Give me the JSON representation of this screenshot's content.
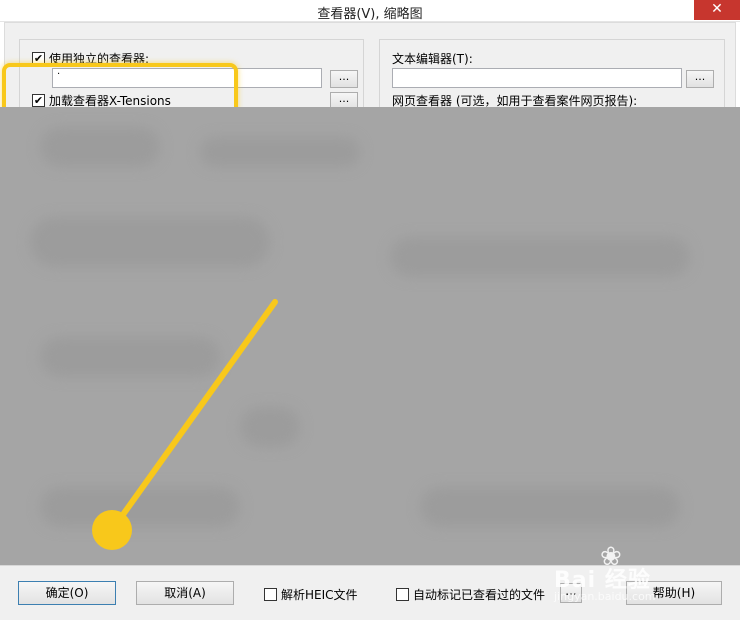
{
  "window": {
    "title": "查看器(V), 缩略图",
    "close_glyph": "✕"
  },
  "left_group": {
    "use_separate_viewer_label": "使用独立的查看器:",
    "use_separate_viewer_checked": true,
    "viewer_path_value": "·",
    "browse_label": "...",
    "load_xtensions_label": "加载查看器X-Tensions",
    "load_xtensions_checked": true
  },
  "right_group": {
    "text_editor_label": "文本编辑器(T):",
    "text_editor_value": "",
    "browse_label": "...",
    "web_viewer_label": "网页查看器 (可选，如用于查看案件网页报告):"
  },
  "footer": {
    "ok_label": "确定(O)",
    "cancel_label": "取消(A)",
    "parse_heic_label": "解析HEIC文件",
    "parse_heic_checked": false,
    "auto_mark_label": "自动标记已查看过的文件",
    "auto_mark_checked": false,
    "more_label": "...",
    "help_label": "帮助(H)"
  },
  "watermark": {
    "brand": "Bai 经验",
    "sub": "jingyan.baidu.com"
  },
  "colors": {
    "highlight": "#f8c81b",
    "close_button": "#c7362e",
    "blur_overlay": "#a5a5a5"
  }
}
